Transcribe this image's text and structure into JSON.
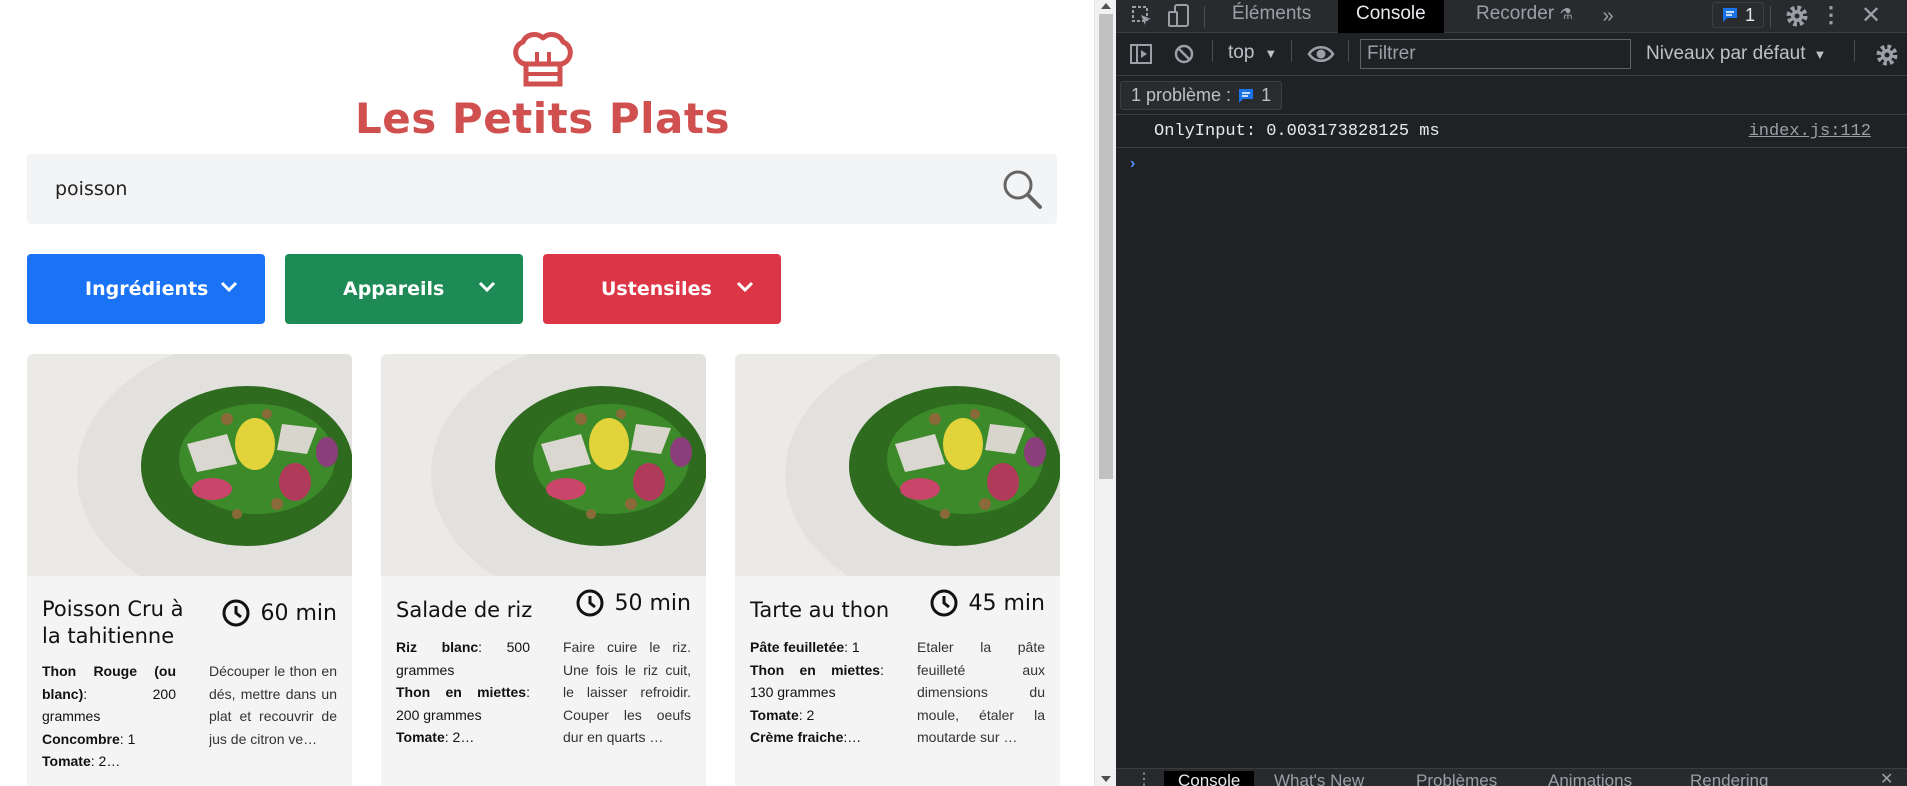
{
  "app": {
    "title": "Les Petits Plats",
    "search": {
      "value": "poisson",
      "placeholder": ""
    },
    "filters": [
      {
        "label": "Ingrédients",
        "color": "#1a73f5"
      },
      {
        "label": "Appareils",
        "color": "#1e8a55"
      },
      {
        "label": "Ustensiles",
        "color": "#dc3545"
      }
    ],
    "recipes": [
      {
        "title": "Poisson Cru à la tahitienne",
        "time": "60 min",
        "ingredients": [
          {
            "name": "Thon Rouge (ou blanc)",
            "qty": ": 200 grammes"
          },
          {
            "name": "Concombre",
            "qty": ": 1"
          },
          {
            "name": "Tomate",
            "qty": ": 2…"
          }
        ],
        "description": "Découper le thon en dés, mettre dans un plat et recouvrir de jus de citron ve…"
      },
      {
        "title": "Salade de riz",
        "time": "50 min",
        "ingredients": [
          {
            "name": "Riz blanc",
            "qty": ": 500 grammes"
          },
          {
            "name": "Thon en miettes",
            "qty": ": 200 grammes"
          },
          {
            "name": "Tomate",
            "qty": ": 2…"
          }
        ],
        "description": "Faire cuire le riz. Une fois le riz cuit, le laisser refroidir. Couper les oeufs dur en quarts …"
      },
      {
        "title": "Tarte au thon",
        "time": "45 min",
        "ingredients": [
          {
            "name": "Pâte feuilletée",
            "qty": ": 1"
          },
          {
            "name": "Thon en miettes",
            "qty": ": 130 grammes"
          },
          {
            "name": "Tomate",
            "qty": ": 2"
          },
          {
            "name": "Crème fraiche",
            "qty": ":…"
          }
        ],
        "description": "Etaler la pâte feuilleté aux dimensions du moule, étaler la moutarde sur …"
      }
    ]
  },
  "devtools": {
    "tabs": [
      "Éléments",
      "Console",
      "Recorder"
    ],
    "active_tab": "Console",
    "issues_count": "1",
    "context": "top",
    "filter_placeholder": "Filtrer",
    "levels": "Niveaux par défaut",
    "problems_label": "1 problème :",
    "problems_count": "1",
    "console_message": "OnlyInput: 0.003173828125 ms",
    "console_source": "index.js:112",
    "prompt": "›",
    "drawer_tabs": [
      "Console",
      "What's New",
      "Problèmes",
      "Animations",
      "Rendering"
    ]
  }
}
